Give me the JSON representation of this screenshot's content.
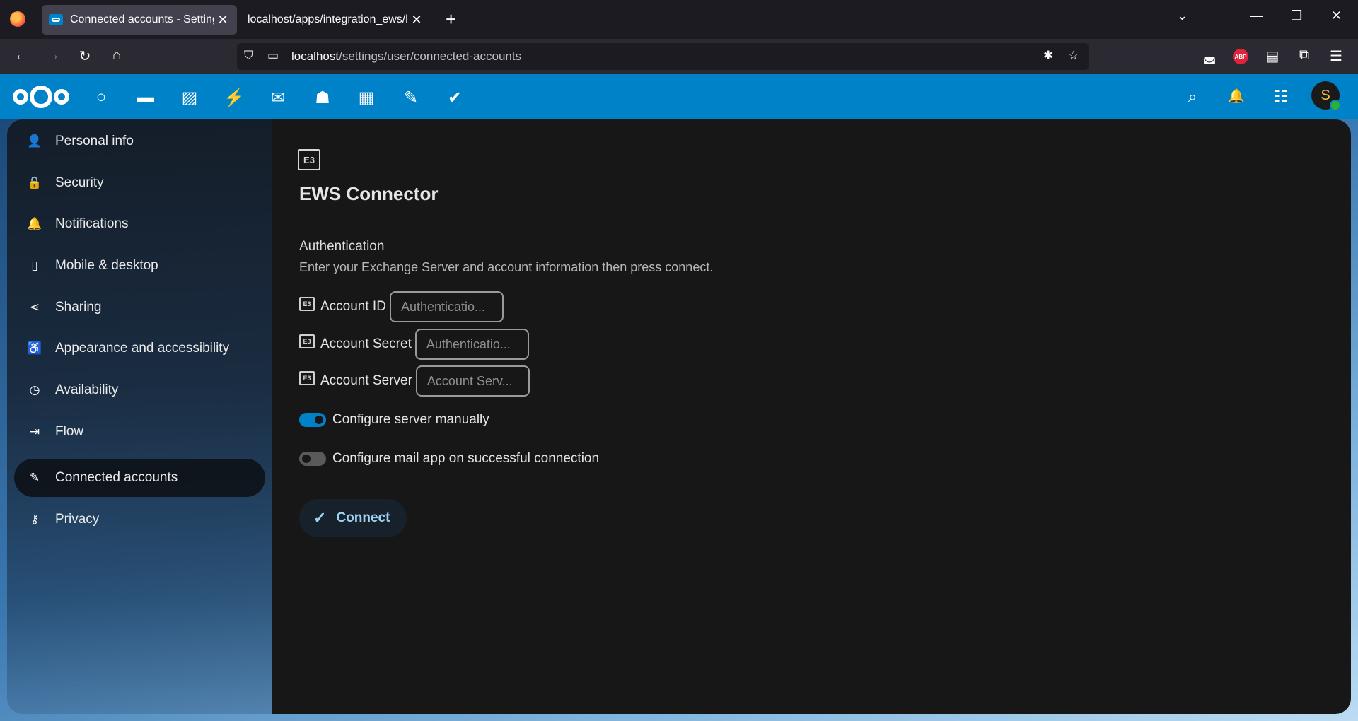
{
  "browser": {
    "tabs": [
      {
        "title": "Connected accounts - Settings - Nextcloud",
        "active": true
      },
      {
        "title": "localhost/apps/integration_ews/lib/",
        "active": false
      }
    ],
    "url_host": "localhost",
    "url_path": "/settings/user/connected-accounts",
    "icons": {
      "back": "←",
      "forward": "→",
      "reload": "↻",
      "home": "⌂",
      "new_tab": "+",
      "tab_close": "✕",
      "list_all_tabs": "⌄",
      "minimize": "—",
      "restore": "❐",
      "close_window": "✕",
      "shield": "⛉",
      "page": "▭",
      "bug": "✱",
      "bookmark": "☆",
      "pocket": "◛",
      "abp_label": "ABP",
      "printer": "▤",
      "extensions": "⧉",
      "menu": "☰"
    }
  },
  "header": {
    "apps": [
      {
        "name": "dashboard",
        "glyph": "○"
      },
      {
        "name": "files",
        "glyph": "▬"
      },
      {
        "name": "photos",
        "glyph": "▨"
      },
      {
        "name": "activity",
        "glyph": "⚡"
      },
      {
        "name": "mail",
        "glyph": "✉"
      },
      {
        "name": "contacts",
        "glyph": "☗"
      },
      {
        "name": "calendar",
        "glyph": "▦"
      },
      {
        "name": "notes",
        "glyph": "✎"
      },
      {
        "name": "tasks",
        "glyph": "✔"
      }
    ],
    "search_glyph": "⌕",
    "notifications_glyph": "🔔",
    "contacts_menu_glyph": "☷",
    "avatar_initial": "S",
    "accent_color": "#0082c9",
    "status_color": "#2fb130"
  },
  "sidebar": {
    "items": [
      {
        "label": "Personal info",
        "icon": "👤",
        "active": false
      },
      {
        "label": "Security",
        "icon": "🔒",
        "active": false
      },
      {
        "label": "Notifications",
        "icon": "🔔",
        "active": false
      },
      {
        "label": "Mobile & desktop",
        "icon": "▯",
        "active": false
      },
      {
        "label": "Sharing",
        "icon": "⋖",
        "active": false
      },
      {
        "label": "Appearance and accessibility",
        "icon": "♿",
        "active": false
      },
      {
        "label": "Availability",
        "icon": "◷",
        "active": false
      },
      {
        "label": "Flow",
        "icon": "⇥",
        "active": false
      },
      {
        "label": "Connected accounts",
        "icon": "✎",
        "active": true
      },
      {
        "label": "Privacy",
        "icon": "⚷",
        "active": false
      }
    ]
  },
  "main": {
    "icon_text": "E3",
    "title": "EWS Connector",
    "section_title": "Authentication",
    "section_desc": "Enter your Exchange Server and account information then press connect.",
    "fields": [
      {
        "label": "Account ID",
        "placeholder": "Authenticatio...",
        "value": ""
      },
      {
        "label": "Account Secret",
        "placeholder": "Authenticatio...",
        "value": ""
      },
      {
        "label": "Account Server",
        "placeholder": "Account Serv...",
        "value": ""
      }
    ],
    "toggles": [
      {
        "label": "Configure server manually",
        "on": true
      },
      {
        "label": "Configure mail app on successful connection",
        "on": false
      }
    ],
    "connect_label": "Connect",
    "connect_glyph": "✓"
  }
}
